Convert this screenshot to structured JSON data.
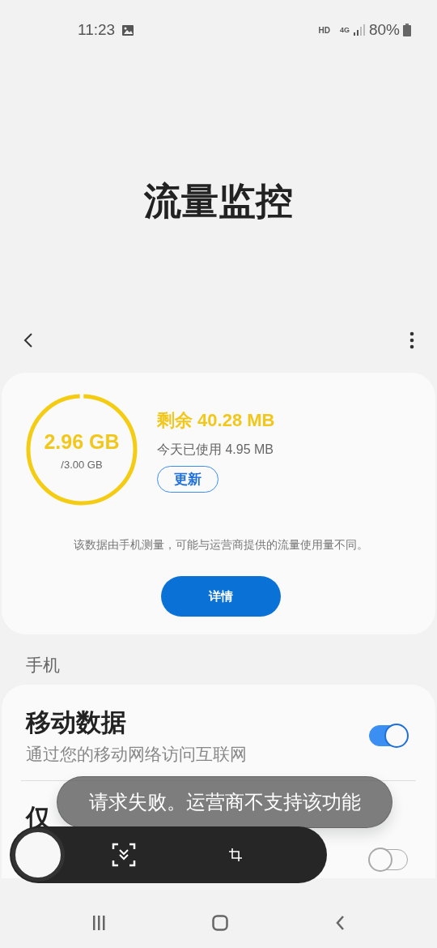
{
  "status_bar": {
    "time": "11:23",
    "hd": "HD",
    "network": "4G",
    "battery": "80%"
  },
  "page_title": "流量监控",
  "usage": {
    "used": "2.96 GB",
    "total": "/3.00 GB",
    "level": 0.987,
    "remaining": "剩余 40.28 MB",
    "today": "今天已使用 4.95 MB",
    "refresh_button": "更新",
    "note": "该数据由手机测量，可能与运营商提供的流量使用量不同。",
    "details_button": "详情"
  },
  "section_header": "手机",
  "settings": [
    {
      "title": "移动数据",
      "subtitle": "通过您的移动网络访问互联网",
      "on": true
    },
    {
      "title": "仅",
      "on": false
    }
  ],
  "toast": "请求失败。运营商不支持该功能"
}
